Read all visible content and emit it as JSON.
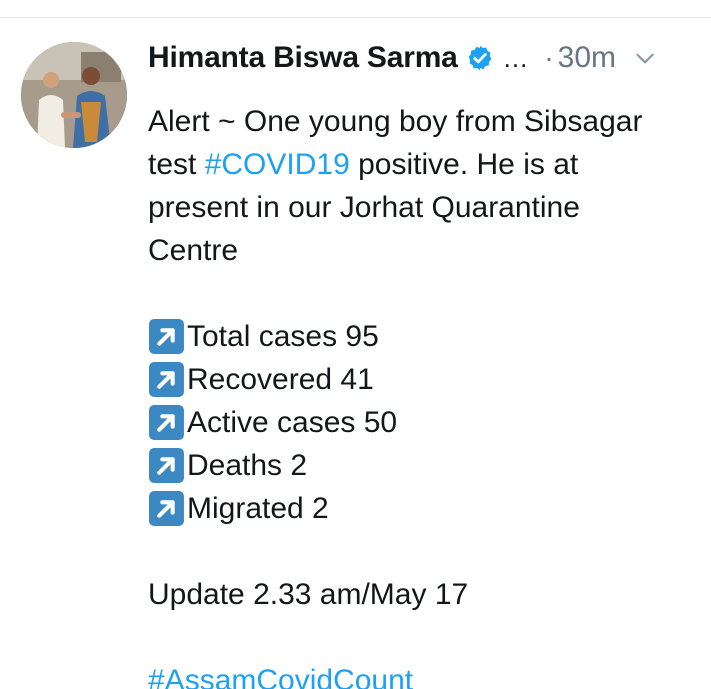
{
  "author": {
    "name": "Himanta Biswa Sarma",
    "truncation": "...",
    "separator": "·",
    "time": "30m",
    "icons": {
      "verified": "verified-badge-icon",
      "menu": "chevron-down-icon"
    }
  },
  "tweet": {
    "lines": [
      "Alert ~ One young boy from Sibsagar",
      "present in our Jorhat Quarantine",
      "Centre"
    ],
    "line2_prefix": "test ",
    "line2_hashtag": "#COVID19",
    "line2_suffix": " positive. He is at",
    "stats": [
      "Total cases 95",
      "Recovered 41",
      "Active cases 50",
      "Deaths 2",
      "Migrated 2"
    ],
    "stat_icon": "up-right-arrow-emoji",
    "update": "Update 2.33 am/May 17",
    "hashtag_footer": "#AssamCovidCount"
  },
  "colors": {
    "text": "#14171a",
    "muted": "#657786",
    "link": "#1da1f2",
    "emoji_box": "#3b88c3"
  }
}
